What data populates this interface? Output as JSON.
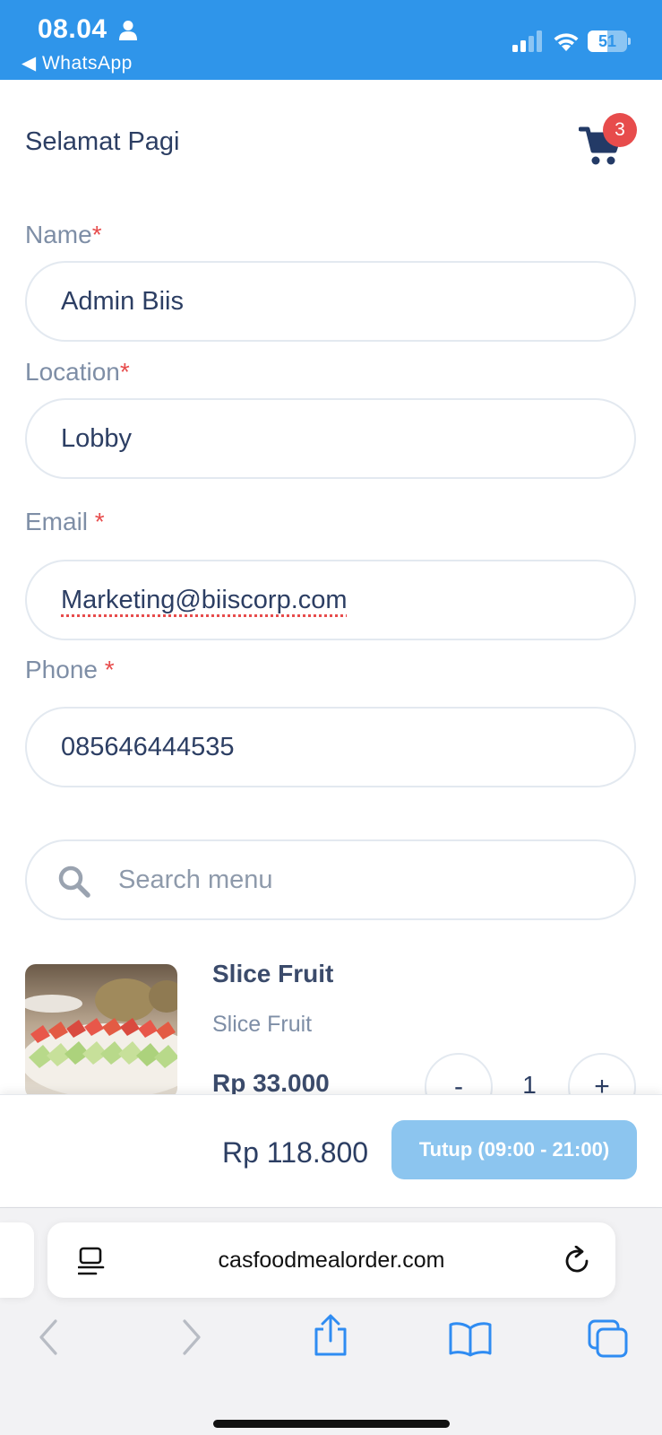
{
  "status_bar": {
    "time": "08.04",
    "back_app": "◀ WhatsApp",
    "battery_level": "51",
    "icons": [
      "person-icon",
      "signal-icon",
      "wifi-icon",
      "battery-icon"
    ]
  },
  "header": {
    "greeting": "Selamat Pagi",
    "cart_count": "3",
    "cart_icon": "cart-icon"
  },
  "form": {
    "name_label": "Name",
    "name_value": "Admin Biis",
    "location_label": "Location",
    "location_value": "Lobby",
    "email_label": "Email",
    "email_value": "Marketing@biiscorp.com",
    "phone_label": "Phone",
    "phone_value": "085646444535",
    "required_mark": "*"
  },
  "search": {
    "placeholder": "Search menu"
  },
  "menu_items": [
    {
      "name": "Slice Fruit",
      "description": "Slice Fruit",
      "price": "Rp 33.000",
      "quantity": "1",
      "minus_label": "-",
      "plus_label": "+"
    }
  ],
  "order_bar": {
    "total": "Rp 118.800",
    "button_label": "Tutup (09:00 - 21:00)"
  },
  "browser": {
    "url": "casfoodmealorder.com",
    "toolbar_icons": [
      "back-icon",
      "forward-icon",
      "share-icon",
      "bookmarks-icon",
      "tabs-icon"
    ]
  },
  "colors": {
    "status_bar": "#2f95ea",
    "text_primary": "#2c3e63",
    "label": "#7e8ea6",
    "required": "#e74c4c",
    "badge": "#e74c4c",
    "disabled_button": "#8cc5ef"
  }
}
